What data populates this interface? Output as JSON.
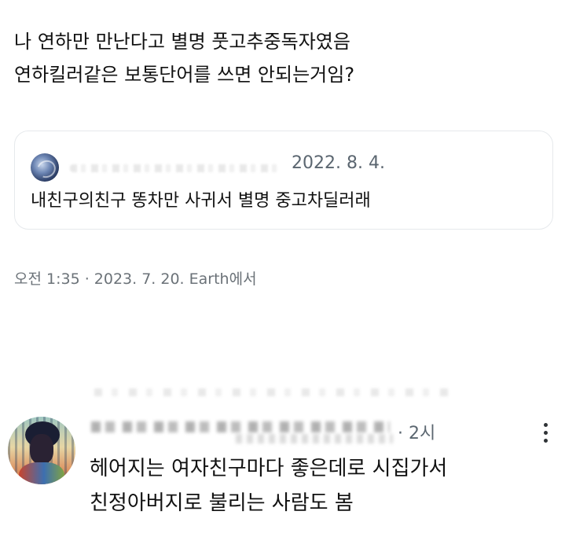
{
  "post": {
    "lines": [
      "나 연하만 만난다고 별명 풋고추중독자였음",
      "연하킬러같은 보통단어를 쓰면 안되는거임?"
    ]
  },
  "quote": {
    "date": "2022. 8. 4.",
    "text": "내친구의친구 똥차만 사귀서 별명 중고차딜러래",
    "avatar_icon": "earth-globe-avatar-icon"
  },
  "timestamp": "오전 1:35 · 2023. 7. 20. Earth에서",
  "reply": {
    "time": "· 2시",
    "lines": [
      "헤어지는 여자친구마다 좋은데로 시집가서",
      "친정아버지로 불리는 사람도 봄"
    ],
    "more_icon": "more-options-icon"
  },
  "colors": {
    "text": "#111111",
    "secondary": "#5b6670",
    "border": "#e6e9ec"
  }
}
